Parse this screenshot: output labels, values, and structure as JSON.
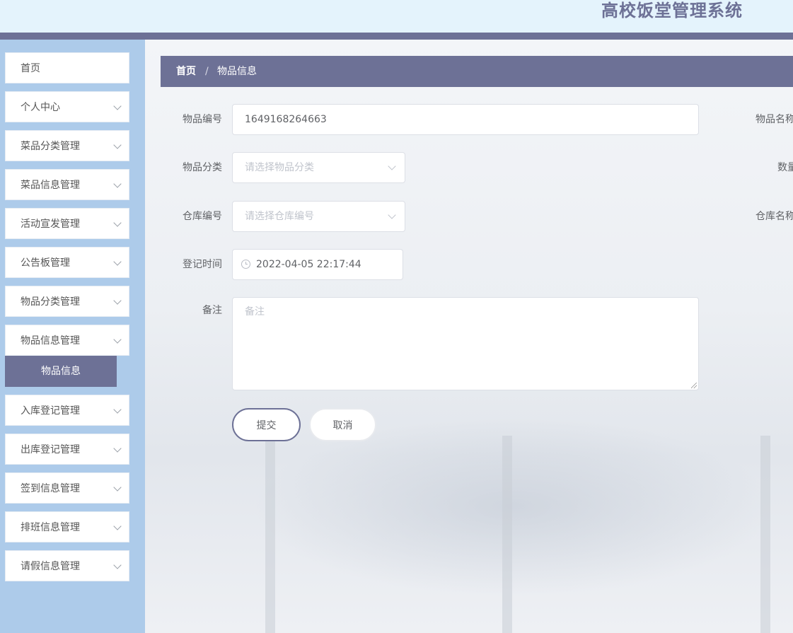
{
  "header": {
    "app_title": "高校饭堂管理系统"
  },
  "sidebar": {
    "items": [
      {
        "label": "首页",
        "has_chevron": false
      },
      {
        "label": "个人中心",
        "has_chevron": true
      },
      {
        "label": "菜品分类管理",
        "has_chevron": true
      },
      {
        "label": "菜品信息管理",
        "has_chevron": true
      },
      {
        "label": "活动宣发管理",
        "has_chevron": true
      },
      {
        "label": "公告板管理",
        "has_chevron": true
      },
      {
        "label": "物品分类管理",
        "has_chevron": true
      },
      {
        "label": "物品信息管理",
        "has_chevron": true
      },
      {
        "label": "入库登记管理",
        "has_chevron": true
      },
      {
        "label": "出库登记管理",
        "has_chevron": true
      },
      {
        "label": "签到信息管理",
        "has_chevron": true
      },
      {
        "label": "排班信息管理",
        "has_chevron": true
      },
      {
        "label": "请假信息管理",
        "has_chevron": true
      }
    ],
    "active_submenu": {
      "label": "物品信息"
    }
  },
  "breadcrumb": {
    "home": "首页",
    "separator": "/",
    "current": "物品信息"
  },
  "form": {
    "item_code": {
      "label": "物品编号",
      "value": "1649168264663"
    },
    "item_name": {
      "label": "物品名称"
    },
    "category": {
      "label": "物品分类",
      "placeholder": "请选择物品分类"
    },
    "quantity": {
      "label": "数量"
    },
    "warehouse_code": {
      "label": "仓库编号",
      "placeholder": "请选择仓库编号"
    },
    "warehouse_name": {
      "label": "仓库名称"
    },
    "register_time": {
      "label": "登记时间",
      "value": "2022-04-05 22:17:44"
    },
    "remark": {
      "label": "备注",
      "placeholder": "备注"
    },
    "submit_label": "提交",
    "cancel_label": "取消"
  },
  "colors": {
    "accent": "#6d7196",
    "sidebar_bg": "#adcbea",
    "header_bg": "#e4f3fc"
  }
}
